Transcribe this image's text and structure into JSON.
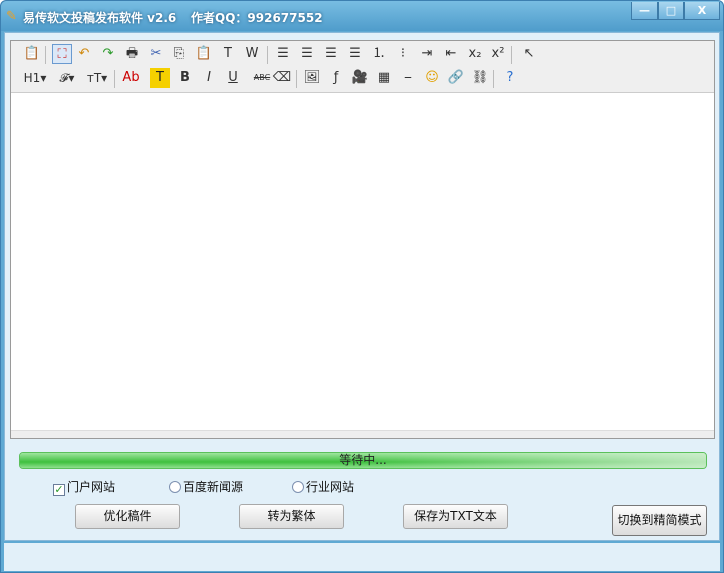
{
  "window": {
    "title": "易传软文投稿发布软件 v2.6",
    "author": "作者QQ：992677552",
    "minimize": "—",
    "maximize": "□",
    "close": "X"
  },
  "toolbar": {
    "row1": [
      {
        "name": "source-icon",
        "glyph": "📋"
      },
      {
        "name": "fullscreen-icon",
        "glyph": "⛶"
      },
      {
        "name": "undo-icon",
        "glyph": "↶"
      },
      {
        "name": "redo-icon",
        "glyph": "↷"
      },
      {
        "name": "print-icon",
        "glyph": "🖶"
      },
      {
        "name": "cut-icon",
        "glyph": "✂"
      },
      {
        "name": "copy-icon",
        "glyph": "⎘"
      },
      {
        "name": "paste-icon",
        "glyph": "📋"
      },
      {
        "name": "paste-text-icon",
        "glyph": "T"
      },
      {
        "name": "paste-word-icon",
        "glyph": "W"
      },
      {
        "name": "align-left-icon",
        "glyph": "☰"
      },
      {
        "name": "align-center-icon",
        "glyph": "☰"
      },
      {
        "name": "align-right-icon",
        "glyph": "☰"
      },
      {
        "name": "justify-icon",
        "glyph": "☰"
      },
      {
        "name": "ordered-list-icon",
        "glyph": "⒈"
      },
      {
        "name": "unordered-list-icon",
        "glyph": "⁝"
      },
      {
        "name": "indent-icon",
        "glyph": "⇥"
      },
      {
        "name": "outdent-icon",
        "glyph": "⇤"
      },
      {
        "name": "subscript-icon",
        "glyph": "x₂"
      },
      {
        "name": "superscript-icon",
        "glyph": "x²"
      },
      {
        "name": "select-all-icon",
        "glyph": "↖"
      }
    ],
    "row2": [
      {
        "name": "heading-icon",
        "glyph": "H1▾"
      },
      {
        "name": "font-family-icon",
        "glyph": "𝓕▾"
      },
      {
        "name": "font-size-icon",
        "glyph": "тT▾"
      },
      {
        "name": "font-color-icon",
        "glyph": "Ab"
      },
      {
        "name": "highlight-icon",
        "glyph": "T"
      },
      {
        "name": "bold-icon",
        "glyph": "B"
      },
      {
        "name": "italic-icon",
        "glyph": "I"
      },
      {
        "name": "underline-icon",
        "glyph": "U"
      },
      {
        "name": "strikethrough-icon",
        "glyph": "ABC"
      },
      {
        "name": "eraser-icon",
        "glyph": "⌫"
      },
      {
        "name": "image-icon",
        "glyph": "🖼"
      },
      {
        "name": "flash-icon",
        "glyph": "ƒ"
      },
      {
        "name": "video-icon",
        "glyph": "🎥"
      },
      {
        "name": "table-icon",
        "glyph": "▦"
      },
      {
        "name": "horizontal-rule-icon",
        "glyph": "⎯"
      },
      {
        "name": "emoticon-icon",
        "glyph": "☺"
      },
      {
        "name": "link-icon",
        "glyph": "🔗"
      },
      {
        "name": "unlink-icon",
        "glyph": "⛓"
      },
      {
        "name": "help-icon",
        "glyph": "?"
      }
    ]
  },
  "progress": {
    "label": "等待中...",
    "value_percent": 100
  },
  "options": {
    "portal": "门户网站",
    "portal_checked": "✓",
    "baidu": "百度新闻源",
    "industry": "行业网站"
  },
  "buttons": {
    "optimize": "优化稿件",
    "traditional": "转为繁体",
    "save_txt": "保存为TXT文本",
    "simple_mode": "切换到精简模式"
  },
  "colors": {
    "title": "#5fa9d3",
    "progress": "#3ec03e"
  }
}
